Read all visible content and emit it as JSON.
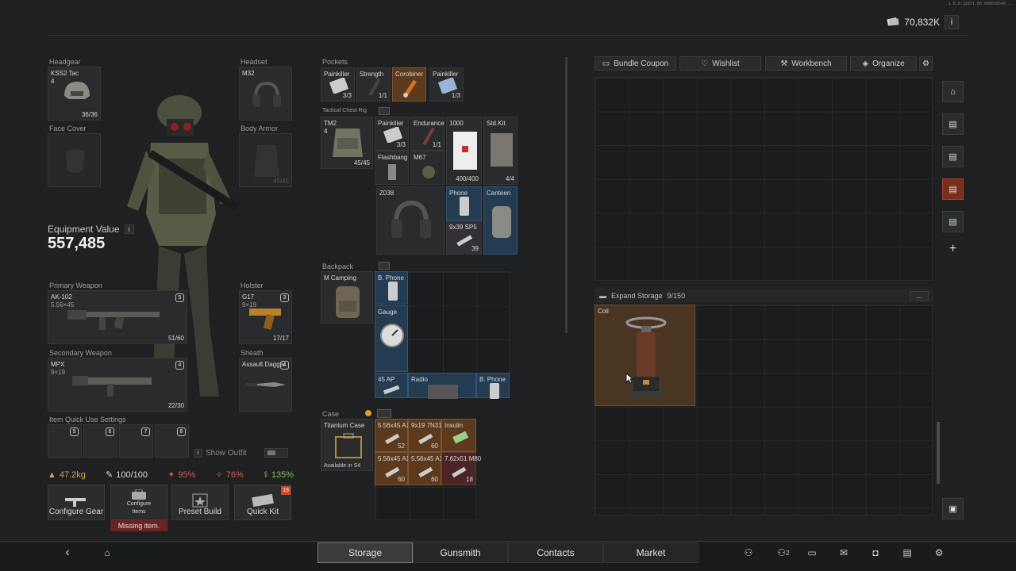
{
  "header": {
    "build_text": "1.0.0.12671.00.000016549...",
    "currency": "70,832K",
    "currency_info": "i"
  },
  "equipment": {
    "headgear": {
      "label": "Headgear",
      "name": "KSS2 Tac",
      "level": "4",
      "count": "36/36"
    },
    "face_cover": {
      "label": "Face Cover"
    },
    "headset": {
      "label": "Headset",
      "name": "M32"
    },
    "body_armor": {
      "label": "Body Armor",
      "count": "45/45"
    },
    "value_label": "Equipment Value",
    "value": "557,485",
    "primary": {
      "label": "Primary Weapon",
      "name": "AK-102",
      "ammo": "5.56×45",
      "slot": "5",
      "count": "51/60"
    },
    "holster": {
      "label": "Holster",
      "name": "G17",
      "ammo": "9×19",
      "slot": "3",
      "count": "17/17"
    },
    "secondary": {
      "label": "Secondary Weapon",
      "name": "MPX",
      "ammo": "9×19",
      "slot": "4",
      "count": "22/30"
    },
    "sheath": {
      "label": "Sheath",
      "name": "Assault Dagger",
      "slot": "4"
    },
    "quick_use_label": "Item Quick Use Settings",
    "quick_slots": [
      "5",
      "6",
      "7",
      "8"
    ],
    "show_outfit": "Show Outfit"
  },
  "stats": {
    "weight": "47.2kg",
    "durability": "100/100",
    "s1": "95%",
    "s2": "76%",
    "s3": "135%"
  },
  "actions": {
    "configure_gear": "Configure Gear",
    "configure_items": "Configure Items",
    "missing_item": "Missing item.",
    "preset_build": "Preset Build",
    "quick_kit": "Quick Kit",
    "quick_kit_badge": "19"
  },
  "pockets": {
    "label": "Pockets",
    "items": [
      {
        "name": "Painkiller",
        "count": "3/3"
      },
      {
        "name": "Strength",
        "count": "1/1"
      },
      {
        "name": "Corobiner",
        "count": ""
      },
      {
        "name": "Painkiller",
        "count": "1/3"
      }
    ]
  },
  "rig": {
    "label": "Tactical Chest Rig",
    "name": "TM2",
    "level": "4",
    "count": "45/45",
    "items": [
      {
        "name": "Painkiller",
        "count": "3/3"
      },
      {
        "name": "Endurance",
        "count": "1/1"
      },
      {
        "name": "1000",
        "count": "400/400"
      },
      {
        "name": "Std.Kit",
        "count": "4/4"
      },
      {
        "name": "Flashbang",
        "count": ""
      },
      {
        "name": "M67",
        "count": ""
      },
      {
        "name": "Z038",
        "count": ""
      },
      {
        "name": "Phone",
        "count": ""
      },
      {
        "name": "Canteen",
        "count": ""
      },
      {
        "name": "9x39 SP5",
        "count": "39"
      }
    ]
  },
  "backpack": {
    "label": "Backpack",
    "name": "M Camping",
    "items": [
      {
        "name": "B. Phone"
      },
      {
        "name": "Gauge"
      },
      {
        "name": "45 AP"
      },
      {
        "name": "Radio"
      },
      {
        "name": "B. Phone"
      }
    ]
  },
  "case": {
    "label": "Case",
    "name": "Titanium Case",
    "availability": "Available in S4",
    "items": [
      {
        "name": "5.56x45 A1",
        "count": "52"
      },
      {
        "name": "9x19 7N31",
        "count": "60"
      },
      {
        "name": "Insulin",
        "count": ""
      },
      {
        "name": "5.56x45 A1",
        "count": "60"
      },
      {
        "name": "5.56x45 A1",
        "count": "60"
      },
      {
        "name": "7.62x51 M80",
        "count": "18"
      }
    ]
  },
  "storage": {
    "tabs": [
      "Bundle Coupon",
      "Wishlist",
      "Workbench",
      "Organize"
    ],
    "expand_label": "Expand Storage",
    "expand_count": "9/150",
    "expand_more": "...",
    "item": {
      "name": "Coil"
    }
  },
  "nav": {
    "tabs": [
      "Storage",
      "Gunsmith",
      "Contacts",
      "Market"
    ],
    "active": "Storage",
    "friends_count": "2"
  },
  "colors": {
    "accent": "#a2412a",
    "orange_item": "#5b3a1e",
    "blue_item": "#233c52",
    "red_item": "#4a2523"
  }
}
